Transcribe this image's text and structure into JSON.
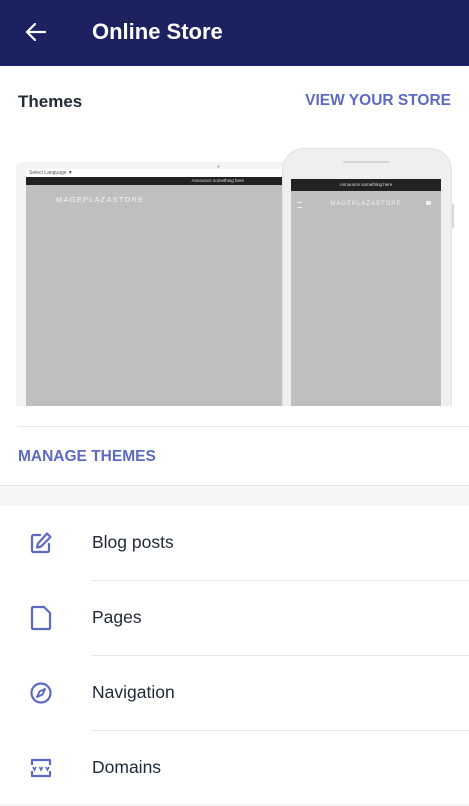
{
  "appbar": {
    "title": "Online Store",
    "back_icon": "arrow-left-icon",
    "background": "#1c2260"
  },
  "themes": {
    "title": "Themes",
    "view_store_label": "VIEW YOUR STORE",
    "manage_label": "MANAGE THEMES",
    "accent": "#5c6ac4",
    "preview": {
      "desktop_language_label": "Select Language ▼",
      "desktop_announcement": "Announce something here",
      "desktop_brand": "MAGEPLAZASTORE",
      "mobile_announcement": "Announce something here",
      "mobile_brand": "MAGEPLAZASTORE"
    }
  },
  "menu": {
    "items": [
      {
        "label": "Blog posts",
        "icon": "edit-pencil-icon"
      },
      {
        "label": "Pages",
        "icon": "page-icon"
      },
      {
        "label": "Navigation",
        "icon": "compass-icon"
      },
      {
        "label": "Domains",
        "icon": "domain-icon"
      }
    ]
  }
}
